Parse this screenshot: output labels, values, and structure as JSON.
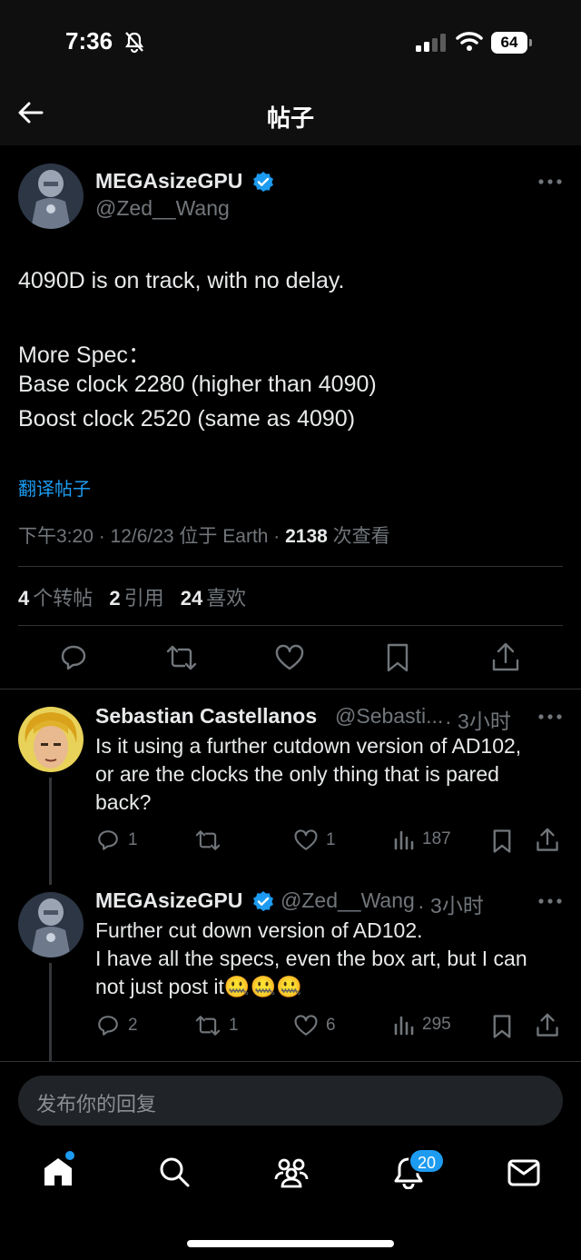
{
  "status": {
    "time": "7:36",
    "battery": "64"
  },
  "header": {
    "title": "帖子"
  },
  "post": {
    "name": "MEGAsizeGPU",
    "handle": "@Zed__Wang",
    "lines": [
      "4090D is on track, with no delay.",
      "More Spec：",
      "Base clock 2280 (higher than 4090)",
      "Boost clock 2520 (same as 4090)"
    ],
    "translate": "翻译帖子",
    "meta_prefix": "下午3:20 · 12/6/23 位于 Earth · ",
    "views": "2138",
    "views_label": " 次查看",
    "stats": {
      "reposts": "4",
      "reposts_label": "个转帖",
      "quotes": "2",
      "quotes_label": "引用",
      "likes": "24",
      "likes_label": "喜欢"
    }
  },
  "replies": [
    {
      "name": "Sebastian Castellanos",
      "handle": "@Sebasti...",
      "time": "· 3小时",
      "lines": [
        "Is it using a further cutdown version of AD102,",
        "or are the clocks the only thing that is pared",
        "back?"
      ],
      "replies": "1",
      "reposts": "",
      "likes": "1",
      "views": "187"
    },
    {
      "name": "MEGAsizeGPU",
      "handle": "@Zed__Wang",
      "time": "· 3小时",
      "lines": [
        "Further cut down version of AD102.",
        "I have all the specs, even the box art, but I can",
        "not just post it🤐🤐🤐"
      ],
      "replies": "2",
      "reposts": "1",
      "likes": "6",
      "views": "295"
    }
  ],
  "compose": {
    "placeholder": "发布你的回复"
  },
  "tabbar": {
    "notifications_badge": "20"
  },
  "colors": {
    "accent": "#1d9bf0",
    "background": "#000000",
    "secondary_text": "#71767b"
  }
}
